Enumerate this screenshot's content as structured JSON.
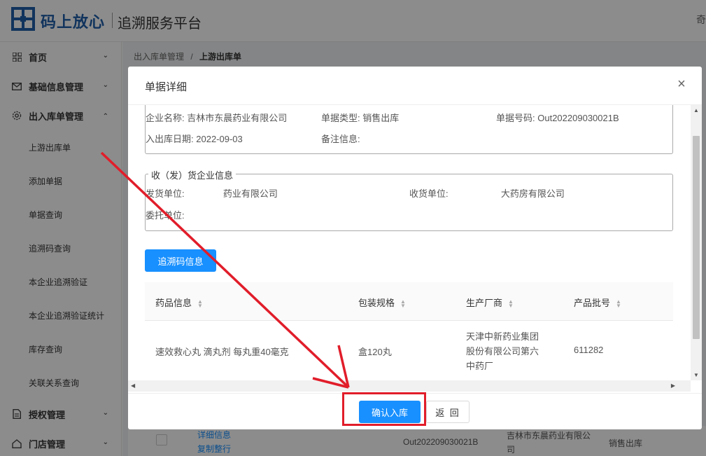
{
  "brand": {
    "name": "码上放心",
    "subtitle": "追溯服务平台",
    "header_right": "奇"
  },
  "sidebar": {
    "items": [
      {
        "label": "首页",
        "icon": "grid-icon",
        "expanded": false
      },
      {
        "label": "基础信息管理",
        "icon": "mail-icon",
        "expanded": false
      },
      {
        "label": "出入库单管理",
        "icon": "gear-icon",
        "expanded": true
      },
      {
        "label": "授权管理",
        "icon": "document-icon",
        "expanded": false
      },
      {
        "label": "门店管理",
        "icon": "home-icon",
        "expanded": false
      }
    ],
    "sub_items": [
      "上游出库单",
      "添加单据",
      "单据查询",
      "追溯码查询",
      "本企业追溯验证",
      "本企业追溯验证统计",
      "库存查询",
      "关联关系查询"
    ]
  },
  "breadcrumb": {
    "parent": "出入库单管理",
    "separator": "/",
    "current": "上游出库单"
  },
  "background_row": {
    "link_detail": "详细信息",
    "link_copy": "复制整行",
    "code": "Out202209030021B",
    "company": "吉林市东晨药业有限公司",
    "type": "销售出库"
  },
  "modal": {
    "title": "单据详细",
    "close": "×",
    "doc_info": {
      "company_label": "企业名称:",
      "company_value": "吉林市东晨药业有限公司",
      "type_label": "单据类型:",
      "type_value": "销售出库",
      "number_label": "单据号码:",
      "number_value": "Out202209030021B",
      "date_label": "入出库日期:",
      "date_value": "2022-09-03",
      "remark_label": "备注信息:",
      "remark_value": ""
    },
    "partner_info": {
      "legend": "收（发）货企业信息",
      "sender_label": "发货单位:",
      "sender_value": "药业有限公司",
      "receiver_label": "收货单位:",
      "receiver_value": "大药房有限公司",
      "agent_label": "委托单位:",
      "agent_value": ""
    },
    "trace_button": "追溯码信息",
    "table": {
      "headers": [
        "药品信息",
        "包装规格",
        "生产厂商",
        "产品批号"
      ],
      "rows": [
        {
          "drug": "速效救心丸 滴丸剂 每丸重40毫克",
          "spec": "盒120丸",
          "maker_lines": [
            "天津中新药业集团",
            "股份有限公司第六",
            "中药厂"
          ],
          "batch": "611282"
        }
      ]
    },
    "confirm_button": "确认入库",
    "back_button": "返 回"
  },
  "colors": {
    "primary": "#1890ff",
    "annotation_red": "#e11d2a",
    "brand_blue": "#1f5fa9"
  }
}
